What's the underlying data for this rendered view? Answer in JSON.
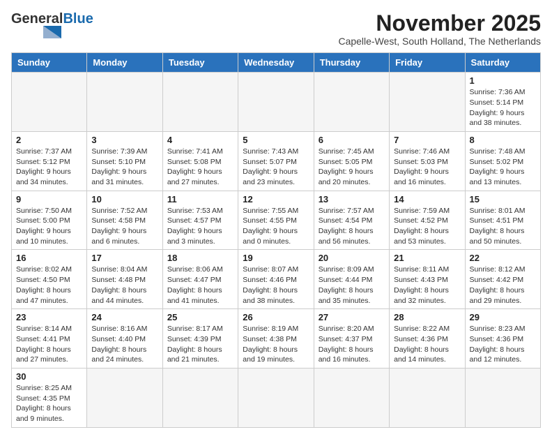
{
  "logo": {
    "general": "General",
    "blue": "Blue"
  },
  "title": {
    "month": "November 2025",
    "location": "Capelle-West, South Holland, The Netherlands"
  },
  "weekdays": [
    "Sunday",
    "Monday",
    "Tuesday",
    "Wednesday",
    "Thursday",
    "Friday",
    "Saturday"
  ],
  "weeks": [
    [
      {
        "day": "",
        "info": ""
      },
      {
        "day": "",
        "info": ""
      },
      {
        "day": "",
        "info": ""
      },
      {
        "day": "",
        "info": ""
      },
      {
        "day": "",
        "info": ""
      },
      {
        "day": "",
        "info": ""
      },
      {
        "day": "1",
        "info": "Sunrise: 7:36 AM\nSunset: 5:14 PM\nDaylight: 9 hours and 38 minutes."
      }
    ],
    [
      {
        "day": "2",
        "info": "Sunrise: 7:37 AM\nSunset: 5:12 PM\nDaylight: 9 hours and 34 minutes."
      },
      {
        "day": "3",
        "info": "Sunrise: 7:39 AM\nSunset: 5:10 PM\nDaylight: 9 hours and 31 minutes."
      },
      {
        "day": "4",
        "info": "Sunrise: 7:41 AM\nSunset: 5:08 PM\nDaylight: 9 hours and 27 minutes."
      },
      {
        "day": "5",
        "info": "Sunrise: 7:43 AM\nSunset: 5:07 PM\nDaylight: 9 hours and 23 minutes."
      },
      {
        "day": "6",
        "info": "Sunrise: 7:45 AM\nSunset: 5:05 PM\nDaylight: 9 hours and 20 minutes."
      },
      {
        "day": "7",
        "info": "Sunrise: 7:46 AM\nSunset: 5:03 PM\nDaylight: 9 hours and 16 minutes."
      },
      {
        "day": "8",
        "info": "Sunrise: 7:48 AM\nSunset: 5:02 PM\nDaylight: 9 hours and 13 minutes."
      }
    ],
    [
      {
        "day": "9",
        "info": "Sunrise: 7:50 AM\nSunset: 5:00 PM\nDaylight: 9 hours and 10 minutes."
      },
      {
        "day": "10",
        "info": "Sunrise: 7:52 AM\nSunset: 4:58 PM\nDaylight: 9 hours and 6 minutes."
      },
      {
        "day": "11",
        "info": "Sunrise: 7:53 AM\nSunset: 4:57 PM\nDaylight: 9 hours and 3 minutes."
      },
      {
        "day": "12",
        "info": "Sunrise: 7:55 AM\nSunset: 4:55 PM\nDaylight: 9 hours and 0 minutes."
      },
      {
        "day": "13",
        "info": "Sunrise: 7:57 AM\nSunset: 4:54 PM\nDaylight: 8 hours and 56 minutes."
      },
      {
        "day": "14",
        "info": "Sunrise: 7:59 AM\nSunset: 4:52 PM\nDaylight: 8 hours and 53 minutes."
      },
      {
        "day": "15",
        "info": "Sunrise: 8:01 AM\nSunset: 4:51 PM\nDaylight: 8 hours and 50 minutes."
      }
    ],
    [
      {
        "day": "16",
        "info": "Sunrise: 8:02 AM\nSunset: 4:50 PM\nDaylight: 8 hours and 47 minutes."
      },
      {
        "day": "17",
        "info": "Sunrise: 8:04 AM\nSunset: 4:48 PM\nDaylight: 8 hours and 44 minutes."
      },
      {
        "day": "18",
        "info": "Sunrise: 8:06 AM\nSunset: 4:47 PM\nDaylight: 8 hours and 41 minutes."
      },
      {
        "day": "19",
        "info": "Sunrise: 8:07 AM\nSunset: 4:46 PM\nDaylight: 8 hours and 38 minutes."
      },
      {
        "day": "20",
        "info": "Sunrise: 8:09 AM\nSunset: 4:44 PM\nDaylight: 8 hours and 35 minutes."
      },
      {
        "day": "21",
        "info": "Sunrise: 8:11 AM\nSunset: 4:43 PM\nDaylight: 8 hours and 32 minutes."
      },
      {
        "day": "22",
        "info": "Sunrise: 8:12 AM\nSunset: 4:42 PM\nDaylight: 8 hours and 29 minutes."
      }
    ],
    [
      {
        "day": "23",
        "info": "Sunrise: 8:14 AM\nSunset: 4:41 PM\nDaylight: 8 hours and 27 minutes."
      },
      {
        "day": "24",
        "info": "Sunrise: 8:16 AM\nSunset: 4:40 PM\nDaylight: 8 hours and 24 minutes."
      },
      {
        "day": "25",
        "info": "Sunrise: 8:17 AM\nSunset: 4:39 PM\nDaylight: 8 hours and 21 minutes."
      },
      {
        "day": "26",
        "info": "Sunrise: 8:19 AM\nSunset: 4:38 PM\nDaylight: 8 hours and 19 minutes."
      },
      {
        "day": "27",
        "info": "Sunrise: 8:20 AM\nSunset: 4:37 PM\nDaylight: 8 hours and 16 minutes."
      },
      {
        "day": "28",
        "info": "Sunrise: 8:22 AM\nSunset: 4:36 PM\nDaylight: 8 hours and 14 minutes."
      },
      {
        "day": "29",
        "info": "Sunrise: 8:23 AM\nSunset: 4:36 PM\nDaylight: 8 hours and 12 minutes."
      }
    ],
    [
      {
        "day": "30",
        "info": "Sunrise: 8:25 AM\nSunset: 4:35 PM\nDaylight: 8 hours and 9 minutes."
      },
      {
        "day": "",
        "info": ""
      },
      {
        "day": "",
        "info": ""
      },
      {
        "day": "",
        "info": ""
      },
      {
        "day": "",
        "info": ""
      },
      {
        "day": "",
        "info": ""
      },
      {
        "day": "",
        "info": ""
      }
    ]
  ]
}
